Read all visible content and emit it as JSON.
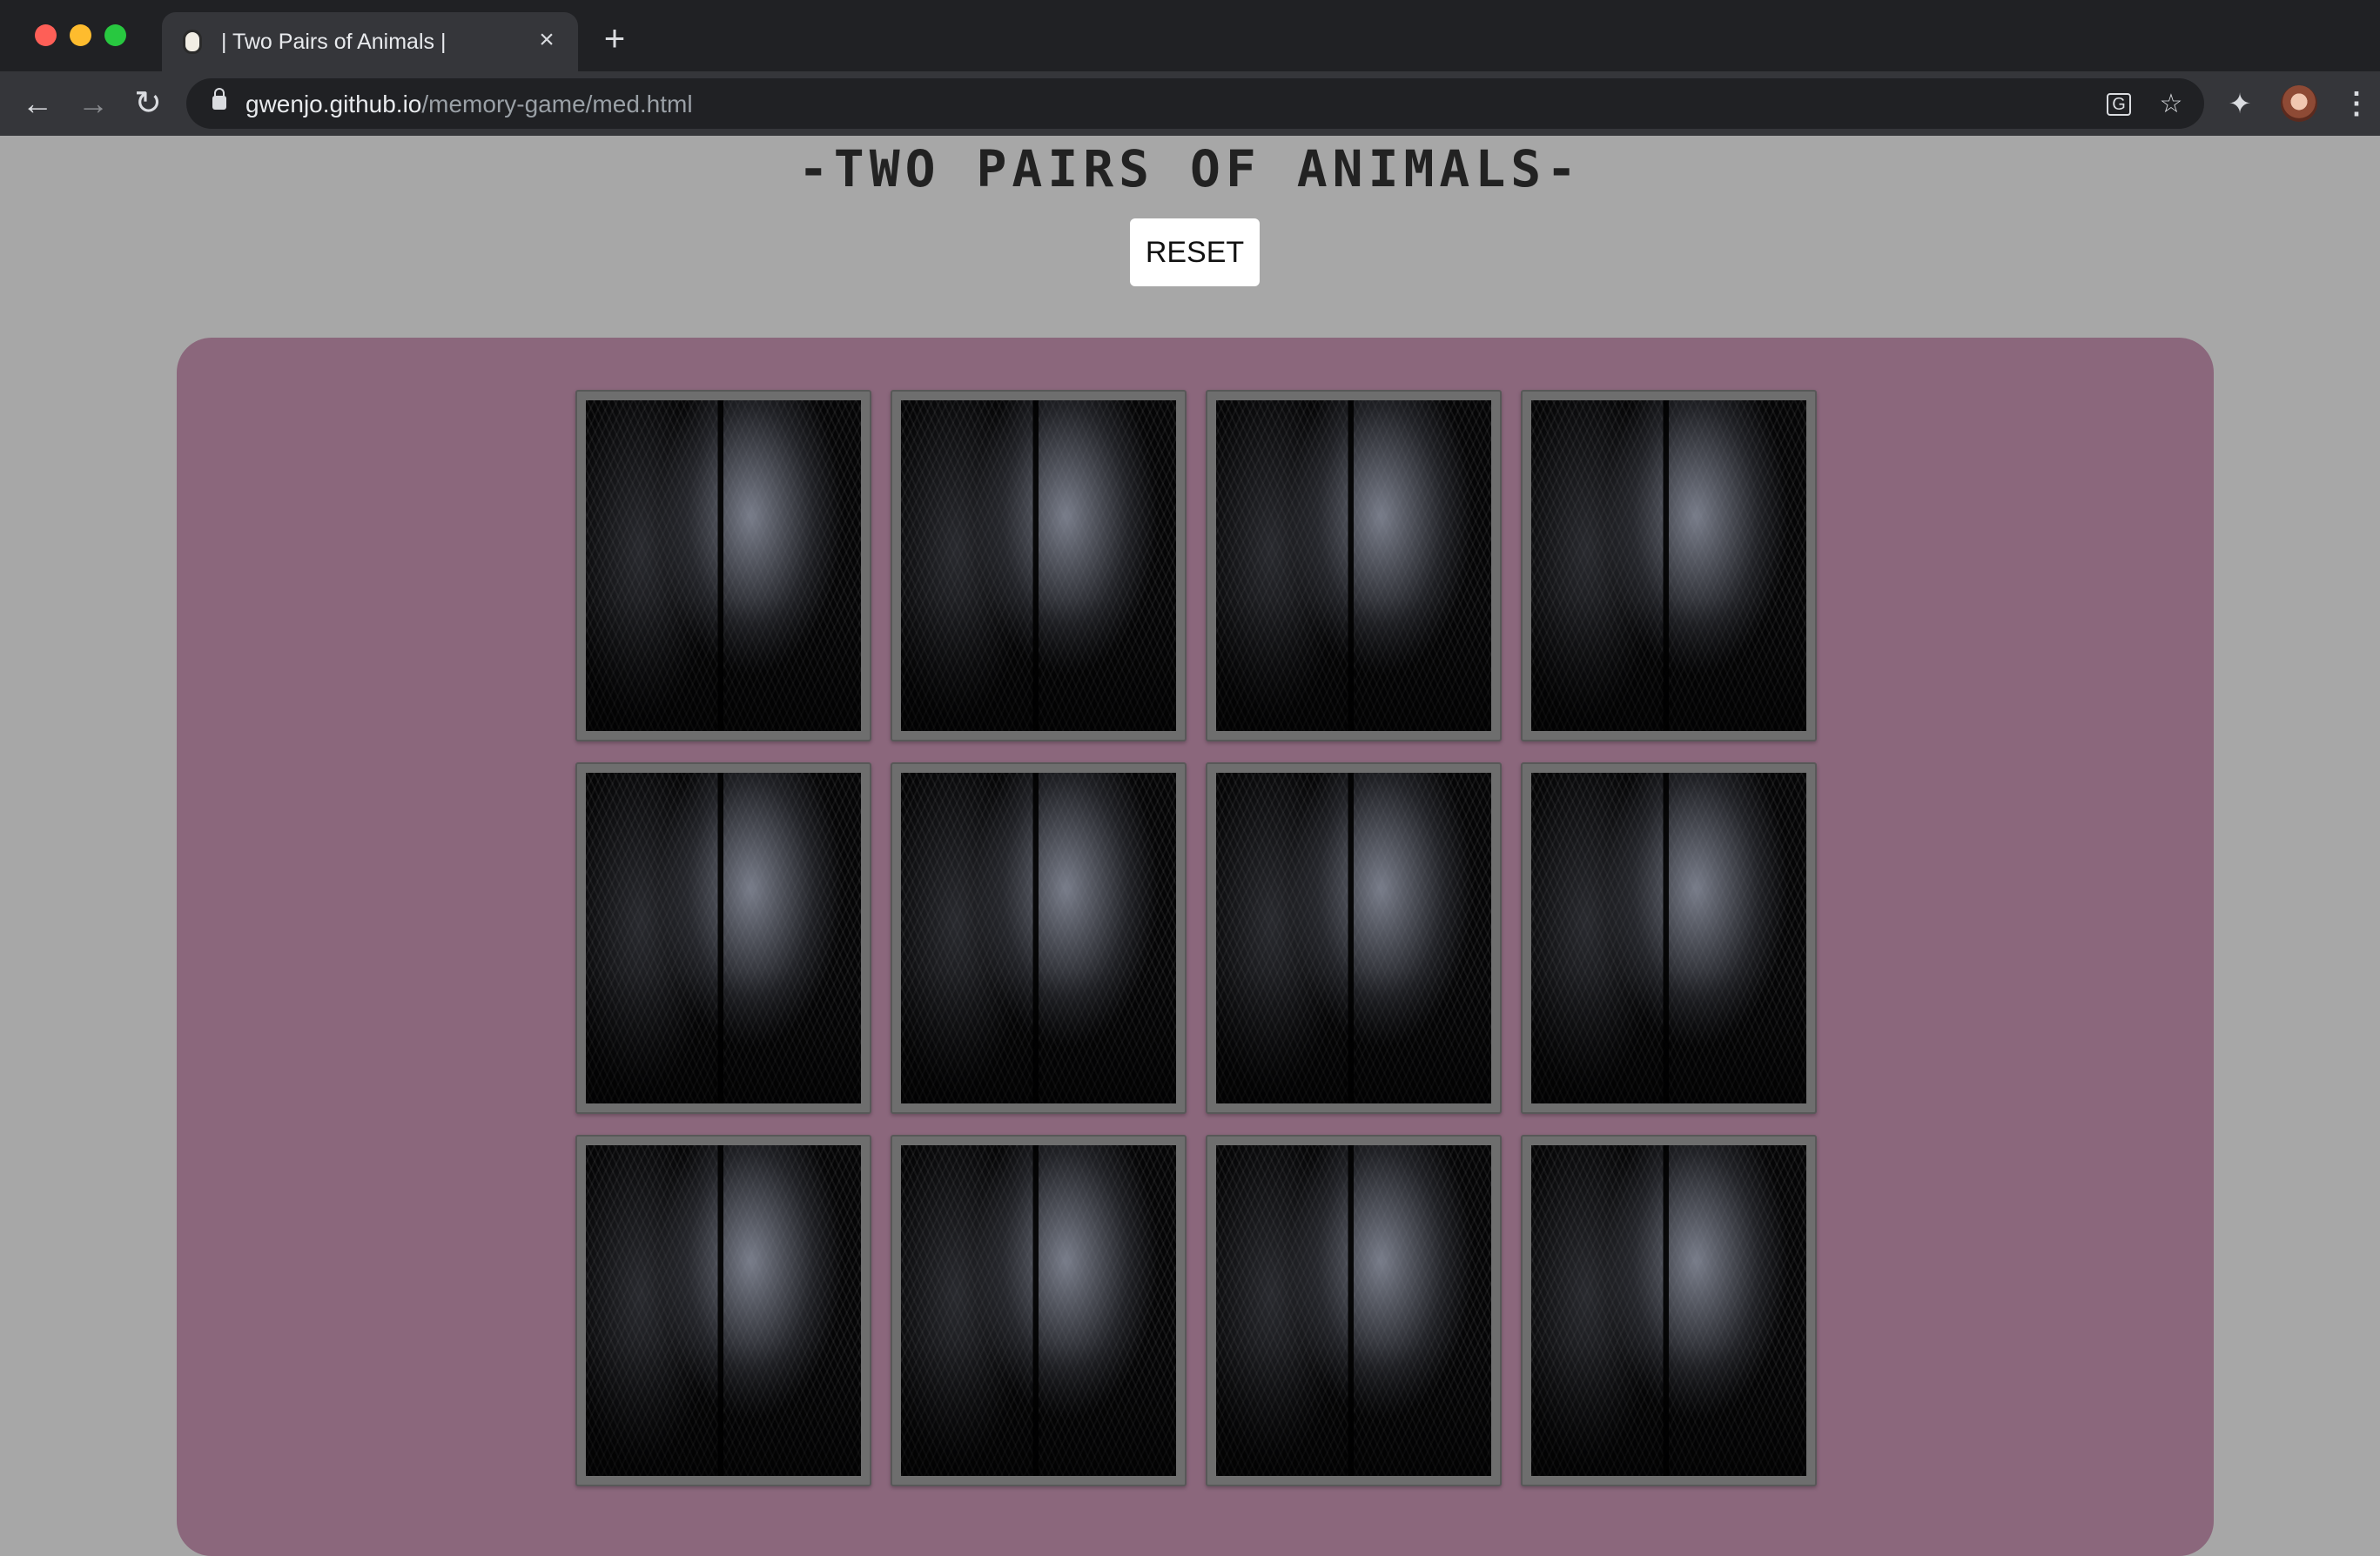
{
  "browser": {
    "tab_title": "| Two Pairs of Animals |",
    "url_host": "gwenjo.github.io",
    "url_path": "/memory-game/med.html",
    "icons": {
      "close": "close-icon",
      "new_tab": "plus-icon",
      "back": "back-arrow-icon",
      "forward": "forward-arrow-icon",
      "reload": "reload-icon",
      "lock": "lock-icon",
      "translate": "translate-icon",
      "bookmark": "star-icon",
      "extensions": "puzzle-icon",
      "menu": "kebab-menu-icon"
    }
  },
  "page": {
    "title": "-TWO PAIRS OF ANIMALS-",
    "reset_label": "RESET",
    "board_color": "#8b677c",
    "background_color": "#a7a7a7"
  },
  "cards": [
    {
      "state": "face-down"
    },
    {
      "state": "face-down"
    },
    {
      "state": "face-down"
    },
    {
      "state": "face-down"
    },
    {
      "state": "face-down"
    },
    {
      "state": "face-down"
    },
    {
      "state": "face-down"
    },
    {
      "state": "face-down"
    },
    {
      "state": "face-down"
    },
    {
      "state": "face-down"
    },
    {
      "state": "face-down"
    },
    {
      "state": "face-down"
    }
  ]
}
